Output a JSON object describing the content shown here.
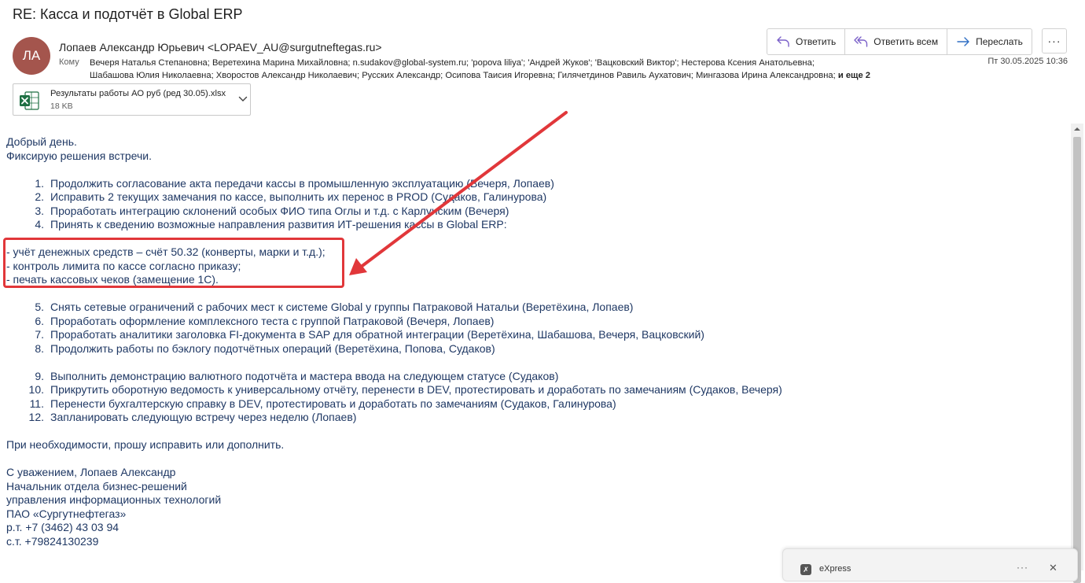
{
  "email": {
    "subject": "RE: Касса и подотчёт в Global ERP",
    "avatar_initials": "ЛА",
    "sender": "Лопаев Александр Юрьевич <LOPAEV_AU@surgutneftegas.ru>",
    "to_label": "Кому",
    "recipients_line1": "Вечеря Наталья Степановна; Веретехина Марина Михайловна; n.sudakov@global-system.ru; 'popova liliya'; 'Андрей Жуков'; 'Вацковский Виктор'; Нестерова Ксения Анатольевна;",
    "recipients_line2": "Шабашова Юлия Николаевна; Хворостов Александр Николаевич; Русских Александр; Осипова Таисия Игоревна; Гилячетдинов Равиль Аухатович; Мингазова Ирина Александровна;",
    "recipients_more": "и еще 2",
    "date": "Пт 30.05.2025 10:36"
  },
  "actions": {
    "reply": "Ответить",
    "reply_all": "Ответить всем",
    "forward": "Переслать",
    "more": "···"
  },
  "attachment": {
    "name": "Результаты работы АО руб (ред 30.05).xlsx",
    "size": "18 KB"
  },
  "body": {
    "greeting": "Добрый день.",
    "intro": "Фиксирую решения встречи.",
    "list1": [
      {
        "num": "1.",
        "text": "Продолжить согласование акта передачи кассы в промышленную эксплуатацию (Вечеря, Лопаев)"
      },
      {
        "num": "2.",
        "text": "Исправить 2 текущих замечания по кассе, выполнить их перенос в PROD (Судаков, Галинурова)"
      },
      {
        "num": "3.",
        "text": "Проработать интеграцию склонений особых ФИО типа Оглы и т.д. с Карлунским (Вечеря)"
      },
      {
        "num": "4.",
        "text": "Принять к сведению возможные направления развития ИТ-решения кассы в Global ERP:"
      }
    ],
    "bullets": [
      "- учёт денежных средств – счёт 50.32 (конверты, марки и т.д.);",
      "- контроль лимита по кассе согласно приказу;",
      "- печать кассовых чеков (замещение 1С)."
    ],
    "list2": [
      {
        "num": "5.",
        "text": "Снять сетевые ограничений с рабочих мест к системе Global у группы Патраковой Натальи (Веретёхина, Лопаев)"
      },
      {
        "num": "6.",
        "text": "Проработать оформление комплексного теста с группой Патраковой (Вечеря, Лопаев)"
      },
      {
        "num": "7.",
        "text": "Проработать аналитики заголовка FI-документа в SAP для обратной интеграции (Веретёхина, Шабашова, Вечеря, Вацковский)"
      },
      {
        "num": "8.",
        "text": "Продолжить работы по бэклогу подотчётных операций (Веретёхина, Попова, Судаков)"
      }
    ],
    "list3": [
      {
        "num": "9.",
        "text": "Выполнить демонстрацию валютного подотчёта и мастера ввода на следующем статусе (Судаков)"
      },
      {
        "num": "10.",
        "text": "Прикрутить оборотную ведомость к универсальному отчёту, перенести в DEV, протестировать и доработать по замечаниям (Судаков, Вечеря)"
      },
      {
        "num": "11.",
        "text": "Перенести бухгалтерскую справку в DEV, протестировать и доработать по замечаниям (Судаков, Галинурова)"
      },
      {
        "num": "12.",
        "text": "Запланировать следующую встречу через неделю (Лопаев)"
      }
    ],
    "closing": "При необходимости, прошу исправить или дополнить.",
    "signature": [
      "С уважением, Лопаев Александр",
      "Начальник отдела бизнес-решений",
      "управления информационных технологий",
      "ПАО «Сургутнефтегаз»",
      "р.т. +7 (3462) 43 03 94",
      "с.т. +79824130239"
    ]
  },
  "notification": {
    "app_name": "eXpress",
    "more": "···",
    "close": "✕"
  },
  "colors": {
    "body_text": "#1f3864",
    "highlight": "#e1373a",
    "avatar": "#a4554d",
    "excel": "#1d6f42"
  }
}
